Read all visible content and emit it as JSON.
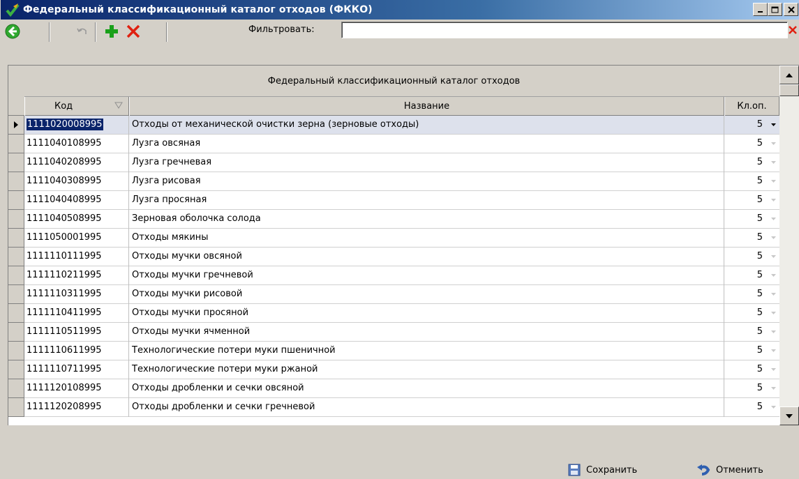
{
  "window": {
    "title": "Федеральный классификационный каталог отходов (ФККО)",
    "buttons": [
      "minimize",
      "maximize",
      "close"
    ]
  },
  "toolbar": {
    "icons": [
      "back-icon",
      "undo-icon",
      "add-icon",
      "delete-icon"
    ],
    "filter_label": "Фильтровать:",
    "filter_value": ""
  },
  "grid": {
    "band_title": "Федеральный классификационный каталог отходов",
    "columns": {
      "code": "Код",
      "name": "Название",
      "cls": "Кл.оп."
    },
    "rows": [
      {
        "code": "1111020008995",
        "name": "Отходы от механической очистки зерна (зерновые отходы)",
        "cls": "5"
      },
      {
        "code": "1111040108995",
        "name": "Лузга овсяная",
        "cls": "5"
      },
      {
        "code": "1111040208995",
        "name": "Лузга гречневая",
        "cls": "5"
      },
      {
        "code": "1111040308995",
        "name": "Лузга рисовая",
        "cls": "5"
      },
      {
        "code": "1111040408995",
        "name": "Лузга просяная",
        "cls": "5"
      },
      {
        "code": "1111040508995",
        "name": "Зерновая оболочка солода",
        "cls": "5"
      },
      {
        "code": "1111050001995",
        "name": "Отходы мякины",
        "cls": "5"
      },
      {
        "code": "1111110111995",
        "name": "Отходы мучки овсяной",
        "cls": "5"
      },
      {
        "code": "1111110211995",
        "name": "Отходы мучки гречневой",
        "cls": "5"
      },
      {
        "code": "1111110311995",
        "name": "Отходы мучки рисовой",
        "cls": "5"
      },
      {
        "code": "1111110411995",
        "name": "Отходы мучки просяной",
        "cls": "5"
      },
      {
        "code": "1111110511995",
        "name": "Отходы мучки ячменной",
        "cls": "5"
      },
      {
        "code": "1111110611995",
        "name": "Технологические потери муки пшеничной",
        "cls": "5"
      },
      {
        "code": "1111110711995",
        "name": "Технологические потери муки ржаной",
        "cls": "5"
      },
      {
        "code": "1111120108995",
        "name": "Отходы дробленки и сечки овсяной",
        "cls": "5"
      },
      {
        "code": "1111120208995",
        "name": "Отходы дробленки и сечки гречневой",
        "cls": "5"
      }
    ]
  },
  "footer": {
    "save_label": "Сохранить",
    "cancel_label": "Отменить"
  },
  "colors": {
    "title_gradient_start": "#0a246a",
    "selection": "#0a246a",
    "selected_row": "#dde1ec",
    "add_green": "#1aa01a",
    "delete_red": "#e02010"
  }
}
